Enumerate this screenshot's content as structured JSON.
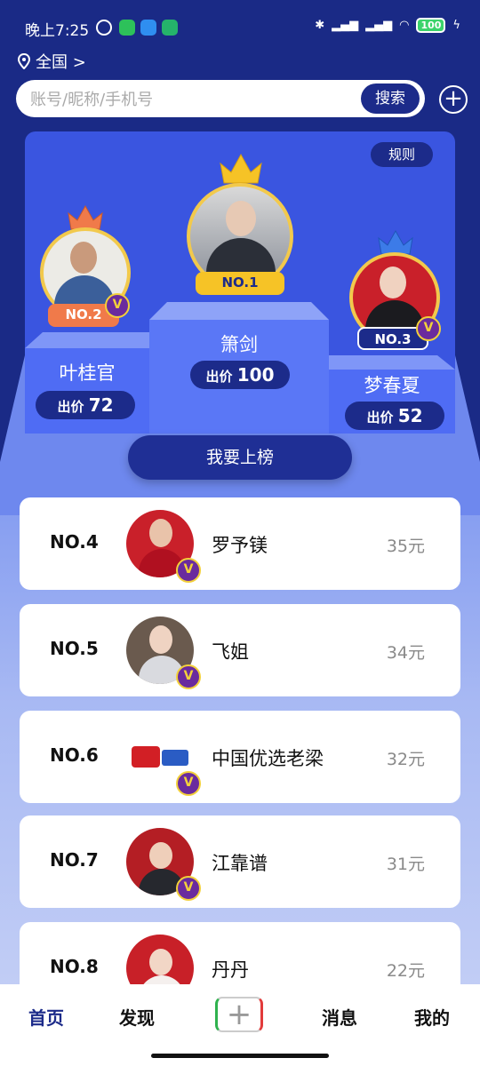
{
  "status": {
    "time": "晚上7:25",
    "battery": "100"
  },
  "location": {
    "label": "全国 >"
  },
  "search": {
    "placeholder": "账号/昵称/手机号",
    "button": "搜索"
  },
  "rules_label": "规则",
  "podium": {
    "first": {
      "name": "箫剑",
      "rank": "NO.1",
      "bid_prefix": "出价",
      "bid": "100"
    },
    "second": {
      "name": "叶桂官",
      "rank": "NO.2",
      "bid_prefix": "出价",
      "bid": "72"
    },
    "third": {
      "name": "梦春夏",
      "rank": "NO.3",
      "bid_prefix": "出价",
      "bid": "52"
    }
  },
  "join_button": "我要上榜",
  "list": [
    {
      "rank": "NO.4",
      "name": "罗予镁",
      "price": "35元"
    },
    {
      "rank": "NO.5",
      "name": "飞姐",
      "price": "34元"
    },
    {
      "rank": "NO.6",
      "name": "中国优选老梁",
      "price": "32元"
    },
    {
      "rank": "NO.7",
      "name": "江靠谱",
      "price": "31元"
    },
    {
      "rank": "NO.8",
      "name": "丹丹",
      "price": "22元"
    }
  ],
  "nav": {
    "home": "首页",
    "discover": "发现",
    "add": "+",
    "messages": "消息",
    "mine": "我的"
  },
  "colors": {
    "primary_dark": "#1c2b8a",
    "podium_blue": "#4f6cf4",
    "active_nav": "#1c2b8a",
    "vip_badge": "#6a2b9e"
  }
}
